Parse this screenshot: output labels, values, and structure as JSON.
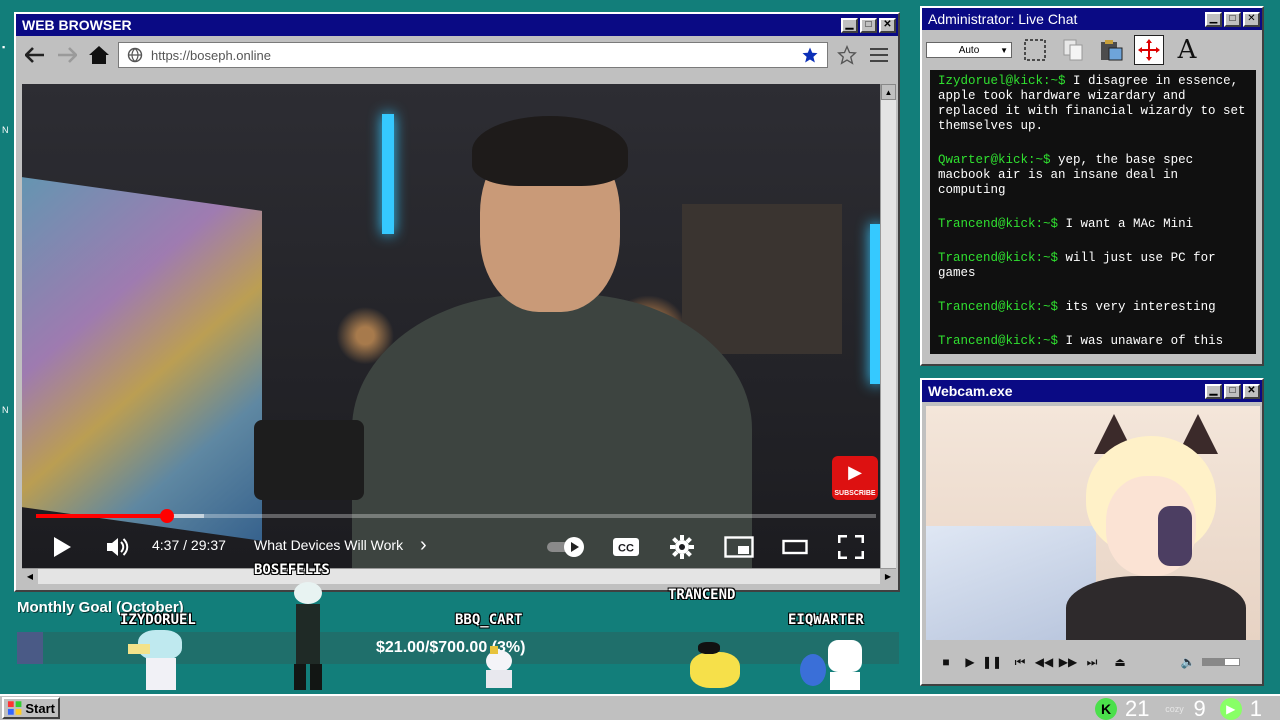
{
  "colors": {
    "desktop": "#127e7a",
    "titlebar": "#0a0a84",
    "chat_username": "#30e030",
    "youtube_red": "#ff0000",
    "star_blue": "#0b2fb8"
  },
  "browser": {
    "title": "WEB BROWSER",
    "url": "https://boseph.online",
    "icons": [
      "back-arrow-icon",
      "forward-arrow-icon",
      "home-icon",
      "globe-icon",
      "star-filled-icon",
      "star-outline-icon",
      "menu-icon"
    ]
  },
  "video": {
    "time": "4:37 / 29:37",
    "chapter": "What Devices Will Work",
    "chapter_arrow": "›",
    "progress_fraction": 0.156,
    "buffered_fraction": 0.2,
    "subscribe_badge": "SUBSCRIBE",
    "icons": [
      "play-icon",
      "volume-icon",
      "autoplay-toggle-icon",
      "captions-icon",
      "settings-icon",
      "miniplayer-icon",
      "theater-icon",
      "fullscreen-icon"
    ]
  },
  "chat": {
    "title": "Administrator: Live Chat",
    "dropdown": "Auto",
    "messages": [
      {
        "user": "Izydoruel@kick:~$",
        "text": "I disagree in essence, apple took hardware wizardary and replaced it with financial wizardy to set themselves up."
      },
      {
        "user": "Qwarter@kick:~$",
        "text": "yep, the base spec macbook air is an insane deal in computing"
      },
      {
        "user": "Trancend@kick:~$",
        "text": "I want a MAc Mini"
      },
      {
        "user": "Trancend@kick:~$",
        "text": "will just use PC for games"
      },
      {
        "user": "Trancend@kick:~$",
        "text": "its very interesting"
      },
      {
        "user": "Trancend@kick:~$",
        "text": "I was unaware of this"
      }
    ]
  },
  "webcam": {
    "title": "Webcam.exe",
    "icons": [
      "stop-icon",
      "play-icon",
      "pause-icon",
      "skip-back-icon",
      "rewind-icon",
      "fast-forward-icon",
      "skip-forward-icon",
      "eject-icon",
      "volume-icon"
    ],
    "volume_fraction": 0.6
  },
  "goal": {
    "title": "Monthly Goal (October)",
    "amount": "$21.00/$700.00 (3%)",
    "fraction": 0.03
  },
  "sprites": [
    {
      "name": "BOSEFELIS"
    },
    {
      "name": "IZYDORUEL"
    },
    {
      "name": "BBQ_CART"
    },
    {
      "name": "TRANCEND"
    },
    {
      "name": "EIQWARTER"
    }
  ],
  "taskbar": {
    "start": "Start",
    "tray": {
      "kick_count": "21",
      "cozy_label": "cozy",
      "cozy_count": "9",
      "live_count": "1"
    }
  }
}
